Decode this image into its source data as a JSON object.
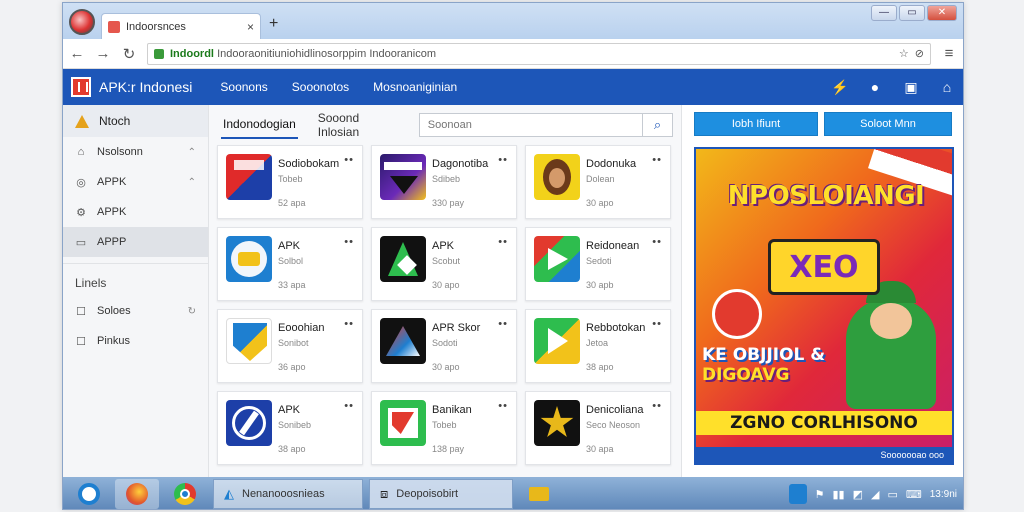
{
  "browser": {
    "tab_title": "Indoorsnces",
    "tab_close": "×",
    "new_tab": "+",
    "url_host": "Indoordl",
    "url_path": "Indooraonitiuniohidlinosorppim Indooranicom",
    "minimize": "—",
    "maximize": "▭",
    "close": "✕"
  },
  "site": {
    "brand": "APK:r Indonesi",
    "nav": [
      "Soonons",
      "Sooonotos",
      "Mosnoaniginian"
    ]
  },
  "sidebar": {
    "top_label": "Ntoch",
    "items": [
      {
        "label": "Nsolsonn",
        "icon": "house-icon"
      },
      {
        "label": "APPK",
        "icon": "game-icon"
      },
      {
        "label": "APPK",
        "icon": "settings-icon"
      },
      {
        "label": "APPP",
        "icon": "download-icon"
      }
    ],
    "section_heading": "Linels",
    "section_items": [
      {
        "label": "Soloes",
        "icon": "checkbox-icon"
      },
      {
        "label": "Pinkus",
        "icon": "checkbox-icon"
      }
    ]
  },
  "main": {
    "tabs": [
      "Indonodogian",
      "Sooond Inlosian"
    ],
    "search_placeholder": "Soonoan",
    "apps": [
      {
        "name": "Sodiobokam",
        "sub": "Tobeb",
        "size": "52 apa"
      },
      {
        "name": "Dagonotiba",
        "sub": "Sdibeb",
        "size": "330 pay"
      },
      {
        "name": "Dodonuka",
        "sub": "Dolean",
        "size": "30 apo"
      },
      {
        "name": "APK",
        "sub": "Solbol",
        "size": "33 apa"
      },
      {
        "name": "APK",
        "sub": "Scobut",
        "size": "30 apo"
      },
      {
        "name": "Reidonean",
        "sub": "Sedoti",
        "size": "30 apb"
      },
      {
        "name": "Eooohian",
        "sub": "Sonibot",
        "size": "36 apo"
      },
      {
        "name": "APR Skor",
        "sub": "Sodoti",
        "size": "30 apo"
      },
      {
        "name": "Rebbotokan",
        "sub": "Jetoa",
        "size": "38 apo"
      },
      {
        "name": "APK",
        "sub": "Sonibeb",
        "size": "38 apo"
      },
      {
        "name": "Banikan",
        "sub": "Tobeb",
        "size": "138 pay"
      },
      {
        "name": "Denicoliana",
        "sub": "Seco Neoson",
        "size": "30 apa"
      }
    ],
    "more": "••"
  },
  "right_panel": {
    "button1": "Iobh Ifiunt",
    "button2": "Soloot Mnn",
    "banner_title": "NPOSLOIANGI",
    "banner_badge": "XEO",
    "banner_line1": "KE OBJJIOL &",
    "banner_line2": "DIGOAVG",
    "banner_line3": "ZGNO CORLHISONO",
    "banner_foot": "Sooooooao ooo"
  },
  "taskbar": {
    "window1": "Nenanooosnieas",
    "window2": "Deopoisobirt",
    "clock": "13:9ni"
  }
}
